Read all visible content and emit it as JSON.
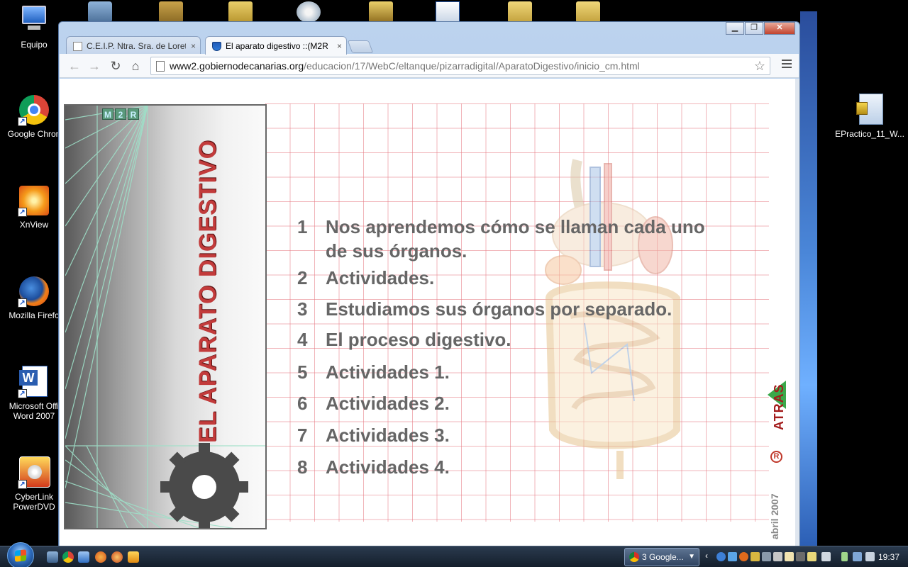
{
  "desktop": {
    "icons": [
      {
        "label": "Equipo",
        "icon": "computer-icon"
      },
      {
        "label": "Google Chron",
        "icon": "chrome-icon"
      },
      {
        "label": "XnView",
        "icon": "xnview-icon"
      },
      {
        "label": "Mozilla Firefo",
        "icon": "firefox-icon"
      },
      {
        "label": "Microsoft Offi Word 2007",
        "icon": "word-icon"
      },
      {
        "label": "CyberLink PowerDVD",
        "icon": "powerdvd-icon"
      }
    ],
    "right_icon": {
      "label": "EPractico_11_W...",
      "icon": "zip-file-icon"
    }
  },
  "browser": {
    "tabs": [
      {
        "title": "C.E.I.P. Ntra. Sra. de Loreto",
        "close": "×"
      },
      {
        "title": "El aparato digestivo ::(M2R",
        "close": "×"
      }
    ],
    "url_domain": "www2.gobiernodecanarias.org",
    "url_path": "/educacion/17/WebC/eltanque/pizarradigital/AparatoDigestivo/inicio_cm.html"
  },
  "page": {
    "cover_logo": [
      "M",
      "2",
      "R"
    ],
    "cover_title": "EL APARATO DIGESTIVO",
    "menu": [
      {
        "num": "1",
        "text": "Nos aprendemos cómo se llaman cada uno",
        "text2": "de sus órganos."
      },
      {
        "num": "2",
        "text": "Actividades."
      },
      {
        "num": "3",
        "text": "Estudiamos sus órganos por separado."
      },
      {
        "num": "4",
        "text": "El proceso digestivo."
      },
      {
        "num": "5",
        "text": "Actividades 1."
      },
      {
        "num": "6",
        "text": "Actividades 2."
      },
      {
        "num": "7",
        "text": "Actividades 3."
      },
      {
        "num": "8",
        "text": "Actividades 4."
      }
    ],
    "back_label": "ATRAS",
    "date_label": "abril 2007",
    "reg_mark": "R"
  },
  "taskbar": {
    "task_label": "3 Google...",
    "clock": "19:37"
  },
  "colors": {
    "menu_text": "#666666",
    "cover_title": "#c23b3b",
    "back_arrow": "#3aa84a",
    "back_text": "#a31c1c",
    "grid": "#e67882"
  }
}
